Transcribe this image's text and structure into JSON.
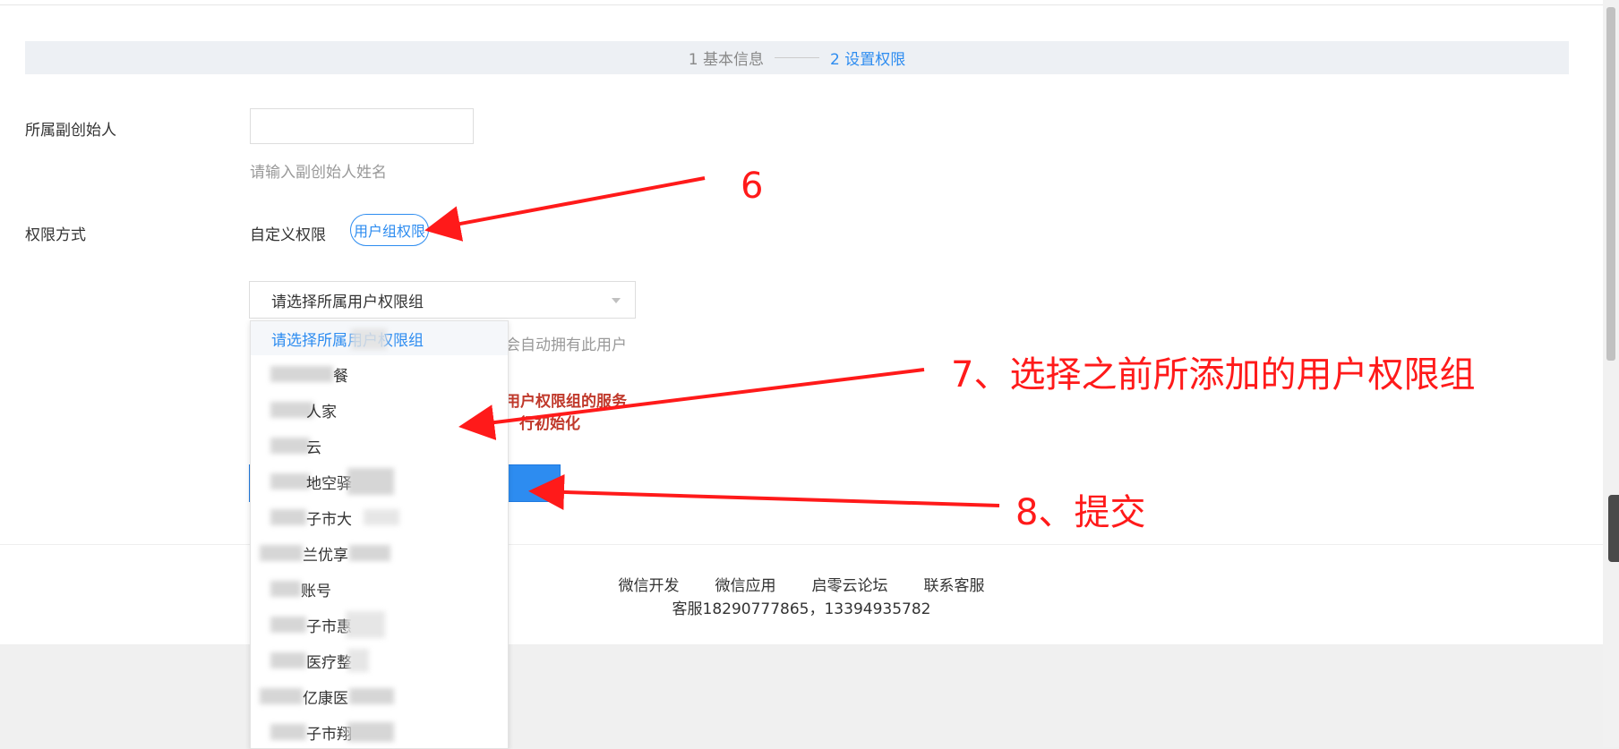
{
  "steps": {
    "step1": "1 基本信息",
    "step2": "2 设置权限"
  },
  "form": {
    "cofounder_label": "所属副创始人",
    "cofounder_value": "",
    "cofounder_hint": "请输入副创始人姓名",
    "permission_label": "权限方式",
    "option_custom": "自定义权限",
    "option_group": "用户组权限",
    "group_select_placeholder": "请选择所属用户权限组",
    "group_hint_partial": "会自动拥有此用户",
    "warning_line1": "用户权限组的服务",
    "warning_line2": "行初始化"
  },
  "dropdown": {
    "items": [
      "请选择所属用户权限组",
      "餐",
      "人家",
      "云",
      "地空驿",
      "子市大",
      "兰优享",
      "账号",
      "子市惠",
      "医疗整",
      "亿康医",
      "子市翔"
    ]
  },
  "footer": {
    "links": [
      "微信开发",
      "微信应用",
      "启零云论坛",
      "联系客服"
    ],
    "phone": "客服18290777865，13394935782"
  },
  "annotations": {
    "a6": "6",
    "a7": "7、选择之前所添加的用户权限组",
    "a8": "8、提交"
  },
  "colors": {
    "accent": "#2d8cf0",
    "annotation": "#ff1a1a",
    "warning": "#c0392b"
  }
}
